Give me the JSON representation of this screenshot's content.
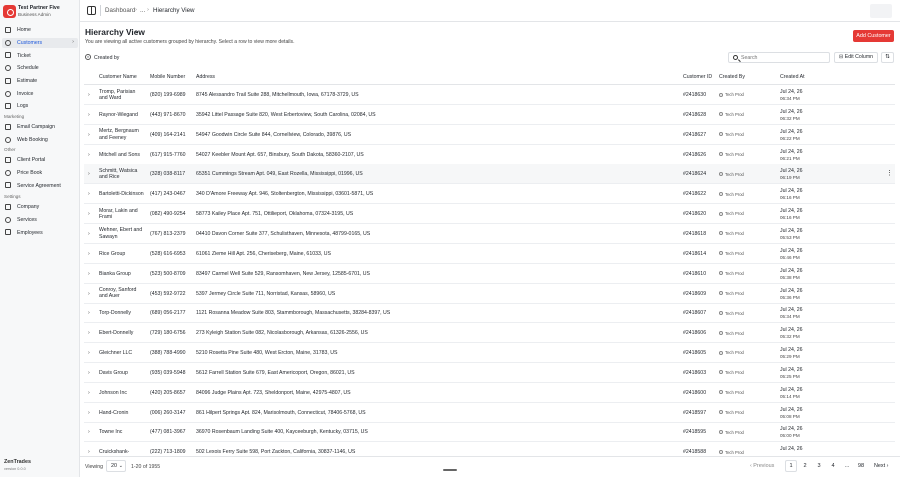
{
  "account": {
    "name": "Test Partner Five",
    "role": "Business Admin"
  },
  "sidebar": {
    "main_items": [
      {
        "label": "Home"
      },
      {
        "label": "Customers"
      },
      {
        "label": "Ticket"
      },
      {
        "label": "Schedule"
      },
      {
        "label": "Estimate"
      },
      {
        "label": "Invoice"
      },
      {
        "label": "Logs"
      }
    ],
    "marketing_title": "Marketing",
    "marketing_items": [
      {
        "label": "Email Campaign"
      },
      {
        "label": "Web Booking"
      }
    ],
    "other_title": "Other",
    "other_items": [
      {
        "label": "Client Portal"
      },
      {
        "label": "Price Book"
      },
      {
        "label": "Service Agreement"
      }
    ],
    "settings_title": "Settings",
    "settings_items": [
      {
        "label": "Company"
      },
      {
        "label": "Services"
      },
      {
        "label": "Employees"
      }
    ],
    "brand": "ZenTrades",
    "version": "version 0.0.0"
  },
  "topbar": {
    "crumb_root": "Dashboard",
    "crumb_mid": "...",
    "crumb_current": "Hierarchy View"
  },
  "header": {
    "title": "Hierarchy View",
    "description": "You are viewing all active customers grouped by hierarchy. Select a row to view more details.",
    "add_label": "Add Customer"
  },
  "toolbar": {
    "group_label": "Created by",
    "search_placeholder": "Search",
    "edit_label": "Edit Column"
  },
  "table": {
    "headers": {
      "name": "Customer Name",
      "mobile": "Mobile Number",
      "address": "Address",
      "id": "Customer ID",
      "created_by": "Created By",
      "created_at": "Created At"
    },
    "rows": [
      {
        "name": "Tromp, Parisian and Ward",
        "mobile": "(820) 199-6989",
        "address": "8745 Alessandro Trail Suite 288, Mitchellmouth, Iowa, 67178-3729, US",
        "id": "#2418630",
        "by": "Tech Prod",
        "date": "Jul 24, 26",
        "time": "06:34 PM"
      },
      {
        "name": "Raynor-Wiegand",
        "mobile": "(443) 971-8670",
        "address": "35942 Littel Passage Suite 820, West Erbertoview, South Carolina, 02084, US",
        "id": "#2418628",
        "by": "Tech Prod",
        "date": "Jul 24, 26",
        "time": "06:32 PM"
      },
      {
        "name": "Mertz, Bergnaum and Feeney",
        "mobile": "(409) 164-2141",
        "address": "54947 Goodwin Circle Suite 844, Cornellview, Colorado, 39876, US",
        "id": "#2418627",
        "by": "Tech Prod",
        "date": "Jul 24, 26",
        "time": "06:22 PM"
      },
      {
        "name": "Mitchell and Sons",
        "mobile": "(617) 915-7760",
        "address": "54027 Keebler Mount Apt. 657, Binsbury, South Dakota, 58360-2107, US",
        "id": "#2418626",
        "by": "Tech Prod",
        "date": "Jul 24, 26",
        "time": "06:21 PM"
      },
      {
        "name": "Schmitt, Watsica and Rice",
        "mobile": "(328) 038-8117",
        "address": "65351 Cummings Stream Apt. 049, East Rozella, Mississippi, 01996, US",
        "id": "#2418624",
        "by": "Tech Prod",
        "date": "Jul 24, 26",
        "time": "06:19 PM"
      },
      {
        "name": "Bartoletti-Dickinson",
        "mobile": "(417) 243-0467",
        "address": "340 D'Amore Freeway Apt. 946, Stoltenbergton, Mississippi, 03601-5871, US",
        "id": "#2418622",
        "by": "Tech Prod",
        "date": "Jul 24, 26",
        "time": "06:16 PM"
      },
      {
        "name": "Morar, Lakin and Frami",
        "mobile": "(082) 490-9254",
        "address": "58773 Kailey Place Apt. 751, Ottilieport, Oklahoma, 07324-3195, US",
        "id": "#2418620",
        "by": "Tech Prod",
        "date": "Jul 24, 26",
        "time": "06:16 PM"
      },
      {
        "name": "Wehner, Ebert and Sawayn",
        "mobile": "(767) 813-2379",
        "address": "04410 Davon Corner Suite 377, Schulisthaven, Minnesota, 48799-0165, US",
        "id": "#2418618",
        "by": "Tech Prod",
        "date": "Jul 24, 26",
        "time": "05:53 PM"
      },
      {
        "name": "Rice Group",
        "mobile": "(528) 616-6953",
        "address": "61061 Zieme Hill Apt. 256, Cheriseberg, Maine, 61033, US",
        "id": "#2418614",
        "by": "Tech Prod",
        "date": "Jul 24, 26",
        "time": "05:46 PM"
      },
      {
        "name": "Bianka Group",
        "mobile": "(523) 500-8709",
        "address": "83497 Carmel Well Suite 529, Ransomhaven, New Jersey, 12585-6701, US",
        "id": "#2418610",
        "by": "Tech Prod",
        "date": "Jul 24, 26",
        "time": "05:38 PM"
      },
      {
        "name": "Conroy, Sanford and Auer",
        "mobile": "(453) 592-9722",
        "address": "5397 Jermey Circle Suite 711, Norristad, Kansas, 58960, US",
        "id": "#2418609",
        "by": "Tech Prod",
        "date": "Jul 24, 26",
        "time": "05:36 PM"
      },
      {
        "name": "Torp-Donnelly",
        "mobile": "(689) 056-2177",
        "address": "1121 Rosanna Meadow Suite 803, Stammborough, Massachusetts, 38284-8397, US",
        "id": "#2418607",
        "by": "Tech Prod",
        "date": "Jul 24, 26",
        "time": "05:34 PM"
      },
      {
        "name": "Ebert-Donnelly",
        "mobile": "(729) 180-6756",
        "address": "273 Kyleigh Station Suite 082, Nicolasborough, Arkansas, 61326-2556, US",
        "id": "#2418606",
        "by": "Tech Prod",
        "date": "Jul 24, 26",
        "time": "05:32 PM"
      },
      {
        "name": "Gleichner LLC",
        "mobile": "(388) 788-4990",
        "address": "5210 Rosetta Pine Suite 480, West Ercton, Maine, 31783, US",
        "id": "#2418605",
        "by": "Tech Prod",
        "date": "Jul 24, 26",
        "time": "05:29 PM"
      },
      {
        "name": "Davis Group",
        "mobile": "(935) 039-5948",
        "address": "5612 Farrell Station Suite 679, East Americoport, Oregon, 86021, US",
        "id": "#2418603",
        "by": "Tech Prod",
        "date": "Jul 24, 26",
        "time": "05:25 PM"
      },
      {
        "name": "Johnson Inc",
        "mobile": "(420) 205-8657",
        "address": "84096 Judge Plains Apt. 723, Sheldonport, Maine, 42975-4807, US",
        "id": "#2418600",
        "by": "Tech Prod",
        "date": "Jul 24, 26",
        "time": "05:14 PM"
      },
      {
        "name": "Hand-Cronin",
        "mobile": "(006) 260-3147",
        "address": "861 Hilpert Springs Apt. 824, Marisolmouth, Connecticut, 78406-5768, US",
        "id": "#2418597",
        "by": "Tech Prod",
        "date": "Jul 24, 26",
        "time": "05:08 PM"
      },
      {
        "name": "Towne Inc",
        "mobile": "(477) 081-3967",
        "address": "36970 Rosenbaum Landing Suite 400, Kaycеeburgh, Kentucky, 03715, US",
        "id": "#2418595",
        "by": "Tech Prod",
        "date": "Jul 24, 26",
        "time": "05:00 PM"
      },
      {
        "name": "Cruickshank-",
        "mobile": "(222) 713-1809",
        "address": "502 Lexois Ferry Suite 598, Port Zackton, California, 30837-1146, US",
        "id": "#2418588",
        "by": "Tech Prod",
        "date": "Jul 24, 26",
        "time": ""
      }
    ]
  },
  "footer": {
    "viewing_label": "Viewing",
    "page_size": "20",
    "range": "1-20 of",
    "total": "1955",
    "prev": "Previous",
    "next": "Next",
    "pages": [
      "1",
      "2",
      "3",
      "4",
      "...",
      "98"
    ]
  }
}
